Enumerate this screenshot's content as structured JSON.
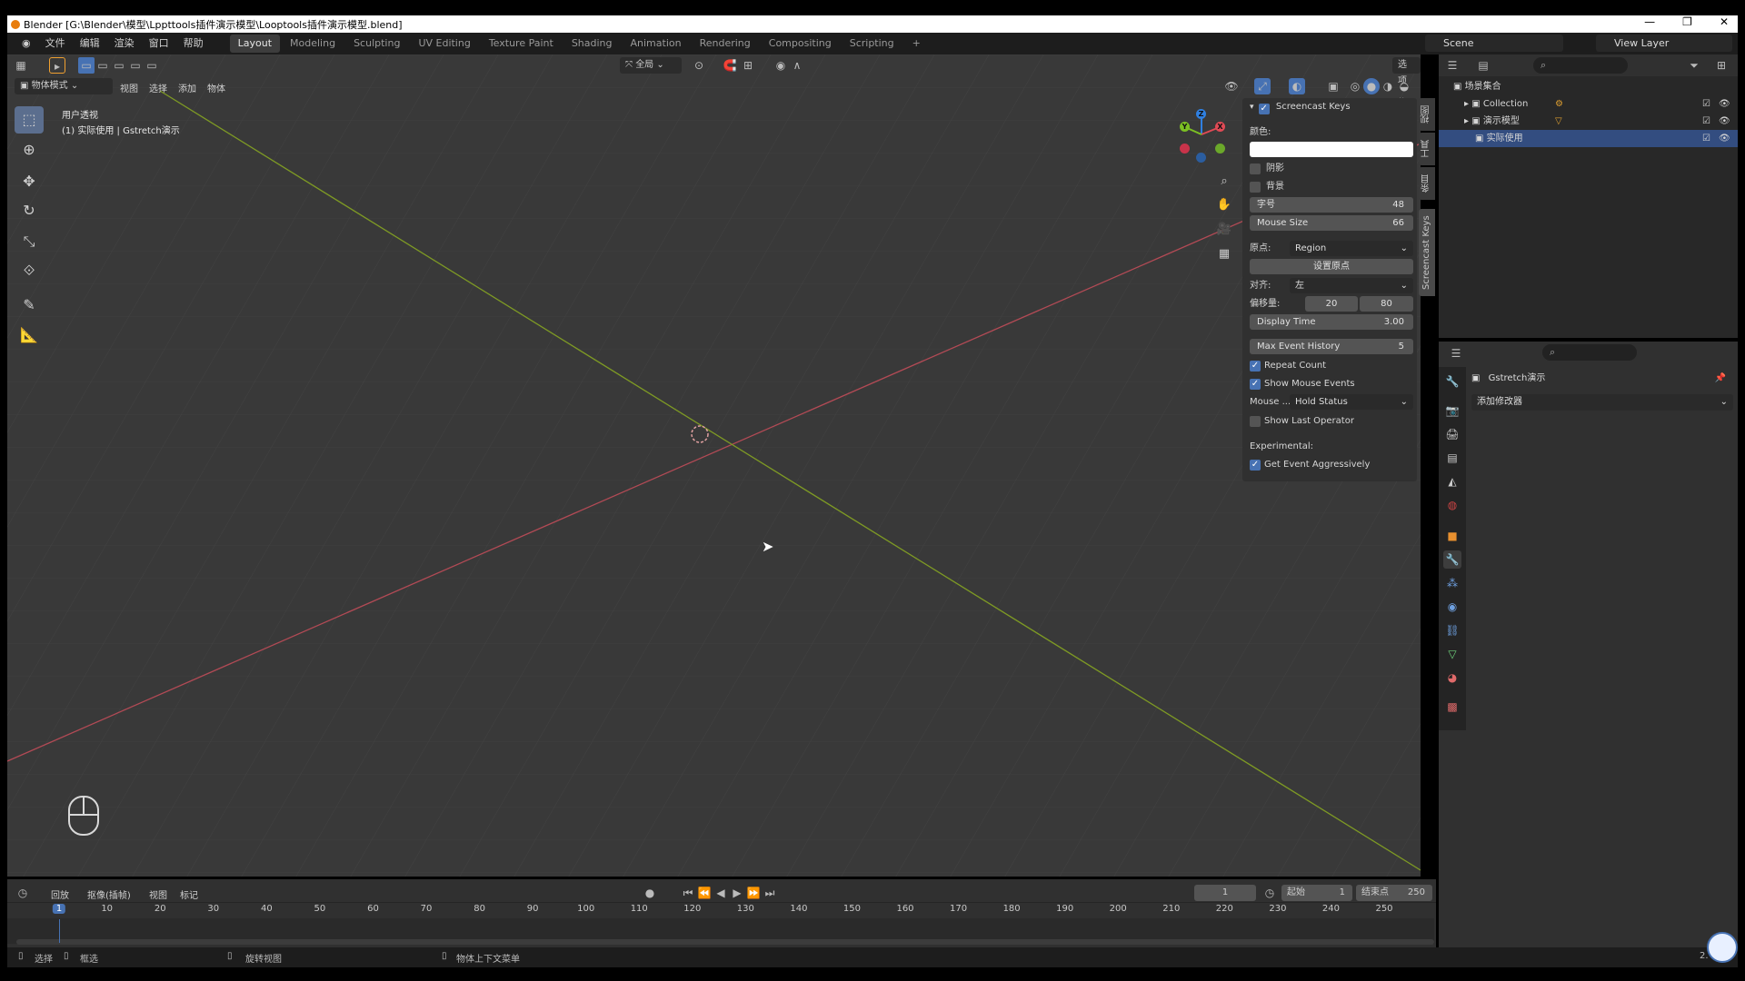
{
  "window": {
    "title": "Blender [G:\\Blender\\模型\\Lppttools插件演示模型\\Looptools插件演示模型.blend]",
    "controls": [
      "—",
      "❐",
      "✕"
    ]
  },
  "menubar": {
    "items": [
      "文件",
      "编辑",
      "渲染",
      "窗口",
      "帮助"
    ],
    "workspaces": [
      "Layout",
      "Modeling",
      "Sculpting",
      "UV Editing",
      "Texture Paint",
      "Shading",
      "Animation",
      "Rendering",
      "Compositing",
      "Scripting"
    ],
    "active_workspace": "Layout",
    "add_tab": "+",
    "scene": "Scene",
    "view_layer": "View Layer"
  },
  "viewport_header": {
    "mode": "物体模式",
    "menus": [
      "视图",
      "选择",
      "添加",
      "物体"
    ],
    "transform_orientation": "全局",
    "options": "选项"
  },
  "viewport": {
    "view_name": "用户透视",
    "object_info": "(1) 实际使用 | Gstretch演示"
  },
  "gizmo": {
    "axes": [
      "X",
      "Y",
      "Z"
    ]
  },
  "npanel": {
    "title": "Screencast Keys",
    "color_label": "颜色:",
    "shadow_label": "阴影",
    "background_label": "背景",
    "font_size_label": "字号",
    "font_size_value": "48",
    "mouse_size_label": "Mouse Size",
    "mouse_size_value": "66",
    "origin_label": "原点:",
    "origin_value": "Region",
    "set_origin_label": "设置原点",
    "align_label": "对齐:",
    "align_value": "左",
    "offset_label": "偏移量:",
    "offset_x": "20",
    "offset_y": "80",
    "display_time_label": "Display Time",
    "display_time_value": "3.00",
    "max_history_label": "Max Event History",
    "max_history_value": "5",
    "repeat_count_label": "Repeat Count",
    "show_mouse_events_label": "Show Mouse Events",
    "mouse_label": "Mouse ...",
    "mouse_value": "Hold Status",
    "show_last_operator_label": "Show Last Operator",
    "experimental_label": "Experimental:",
    "get_event_label": "Get Event Aggressively",
    "side_tabs": [
      "Screencast Keys",
      "视图",
      "工具",
      "条目"
    ]
  },
  "outliner": {
    "root": "场景集合",
    "rows": [
      "Collection",
      "演示模型",
      "实际使用"
    ]
  },
  "properties": {
    "object_name": "Gstretch演示",
    "add_modifier": "添加修改器"
  },
  "timeline": {
    "menus": [
      "回放",
      "抠像(插帧)",
      "视图",
      "标记"
    ],
    "current_frame": "1",
    "start_label": "起始",
    "start_value": "1",
    "end_label": "结束点",
    "end_value": "250",
    "ruler": [
      "1",
      "10",
      "20",
      "30",
      "40",
      "50",
      "60",
      "70",
      "80",
      "90",
      "100",
      "110",
      "120",
      "130",
      "140",
      "150",
      "160",
      "170",
      "180",
      "190",
      "200",
      "210",
      "220",
      "230",
      "240",
      "250"
    ]
  },
  "statusbar": {
    "items": [
      "选择",
      "框选",
      "旋转视图",
      "物体上下文菜单"
    ],
    "version": "2."
  }
}
